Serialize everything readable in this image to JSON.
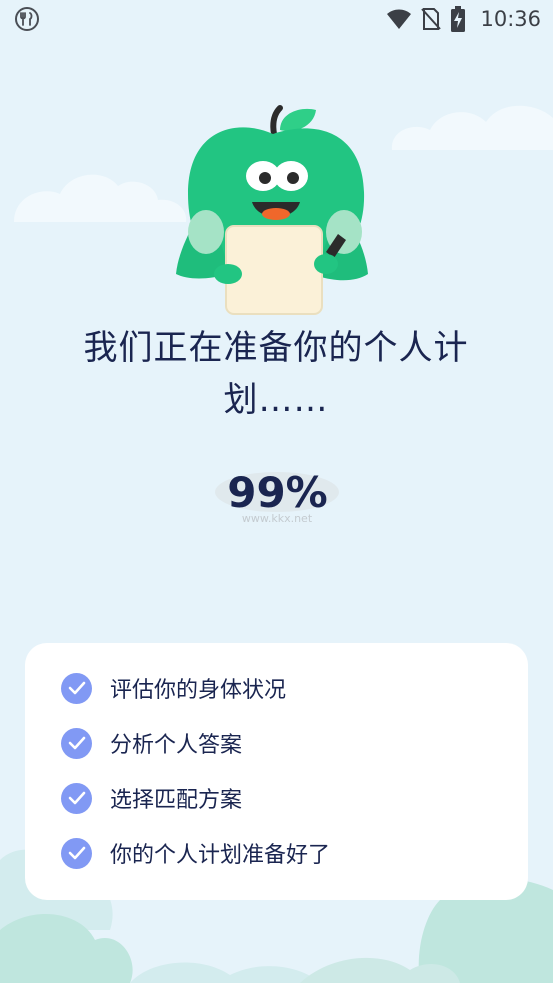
{
  "status_bar": {
    "time": "10:36",
    "icons": [
      "restaurant-icon",
      "wifi-icon",
      "no-sim-icon",
      "battery-charging-icon"
    ]
  },
  "mascot": {
    "icon": "apple-mascot-icon"
  },
  "loading": {
    "title": "我们正在准备你的个人计划……",
    "percent": "99%",
    "progress_value": 0.99
  },
  "watermark": {
    "text": "www.kkx.net"
  },
  "steps": [
    {
      "label": "评估你的身体状况",
      "icon": "check-circle-icon"
    },
    {
      "label": "分析个人答案",
      "icon": "check-circle-icon"
    },
    {
      "label": "选择匹配方案",
      "icon": "check-circle-icon"
    },
    {
      "label": "你的个人计划准备好了",
      "icon": "check-circle-icon"
    }
  ],
  "colors": {
    "background": "#e6f3fa",
    "text": "#1a2550",
    "check": "#8199f4",
    "mascot_green": "#22c582"
  }
}
